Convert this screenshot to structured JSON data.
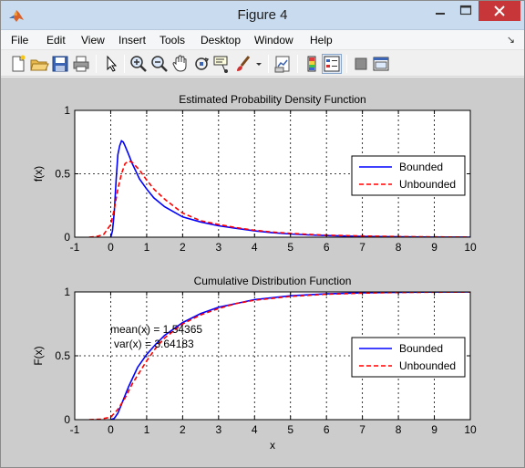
{
  "window": {
    "title": "Figure 4"
  },
  "menu": [
    "File",
    "Edit",
    "View",
    "Insert",
    "Tools",
    "Desktop",
    "Window",
    "Help"
  ],
  "menu_overflow_icon": "dock-arrow-icon",
  "toolbar": {
    "buttons": [
      {
        "name": "new-figure-button",
        "icon": "new-file-icon"
      },
      {
        "name": "open-file-button",
        "icon": "folder-icon"
      },
      {
        "name": "save-figure-button",
        "icon": "save-icon"
      },
      {
        "name": "print-figure-button",
        "icon": "printer-icon"
      },
      {
        "name": "edit-plot-button",
        "icon": "pointer-arrow-icon"
      },
      {
        "name": "zoom-in-button",
        "icon": "zoom-in-icon"
      },
      {
        "name": "zoom-out-button",
        "icon": "zoom-out-icon"
      },
      {
        "name": "pan-button",
        "icon": "hand-icon"
      },
      {
        "name": "rotate-3d-button",
        "icon": "rotate-icon"
      },
      {
        "name": "data-cursor-button",
        "icon": "data-cursor-icon"
      },
      {
        "name": "brush-button",
        "icon": "brush-icon"
      },
      {
        "name": "link-plot-button",
        "icon": "link-icon"
      },
      {
        "name": "insert-colorbar-button",
        "icon": "colorbar-icon"
      },
      {
        "name": "insert-legend-button",
        "icon": "legend-icon",
        "active": true
      },
      {
        "name": "hide-plot-tools-button",
        "icon": "gray-square-icon"
      },
      {
        "name": "show-plot-tools-button",
        "icon": "window-icon"
      }
    ]
  },
  "colors": {
    "bounded": "#0000ff",
    "unbounded": "#ff0000",
    "figure_bg": "#cccccc"
  },
  "chart_data": [
    {
      "type": "line",
      "title": "Estimated Probability Density Function",
      "xlabel": "",
      "ylabel": "f(x)",
      "xlim": [
        -1,
        10
      ],
      "ylim": [
        0,
        1
      ],
      "xticks": [
        -1,
        0,
        1,
        2,
        3,
        4,
        5,
        6,
        7,
        8,
        9,
        10
      ],
      "yticks": [
        0,
        0.5,
        1
      ],
      "ytick_labels": [
        "0",
        "0.5",
        "1"
      ],
      "grid": true,
      "legend": "right",
      "series": [
        {
          "name": "Bounded",
          "style": "solid",
          "x": [
            0,
            0.05,
            0.1,
            0.15,
            0.2,
            0.25,
            0.3,
            0.35,
            0.4,
            0.5,
            0.6,
            0.7,
            0.8,
            1.0,
            1.2,
            1.5,
            2.0,
            2.5,
            3.0,
            3.5,
            4.0,
            4.5,
            5.0,
            5.5,
            6.0,
            7.0,
            8.0,
            9.0,
            10.0
          ],
          "y": [
            0,
            0.05,
            0.2,
            0.45,
            0.65,
            0.72,
            0.76,
            0.75,
            0.72,
            0.65,
            0.58,
            0.52,
            0.46,
            0.38,
            0.31,
            0.24,
            0.16,
            0.12,
            0.09,
            0.07,
            0.05,
            0.035,
            0.025,
            0.018,
            0.013,
            0.006,
            0.003,
            0.001,
            0.0
          ]
        },
        {
          "name": "Unbounded",
          "style": "dashed",
          "x": [
            -0.6,
            -0.4,
            -0.2,
            0,
            0.1,
            0.2,
            0.3,
            0.4,
            0.5,
            0.6,
            0.8,
            1.0,
            1.2,
            1.5,
            2.0,
            2.5,
            3.0,
            3.5,
            4.0,
            4.5,
            5.0,
            5.5,
            6.0,
            7.0,
            8.0,
            9.0,
            10.0
          ],
          "y": [
            0,
            0.005,
            0.02,
            0.1,
            0.22,
            0.38,
            0.5,
            0.58,
            0.6,
            0.59,
            0.53,
            0.45,
            0.38,
            0.3,
            0.19,
            0.13,
            0.1,
            0.075,
            0.055,
            0.04,
            0.03,
            0.022,
            0.016,
            0.009,
            0.005,
            0.002,
            0.001
          ]
        }
      ]
    },
    {
      "type": "line",
      "title": "Cumulative Distribution Function",
      "xlabel": "x",
      "ylabel": "F(x)",
      "xlim": [
        -1,
        10
      ],
      "ylim": [
        0,
        1
      ],
      "xticks": [
        -1,
        0,
        1,
        2,
        3,
        4,
        5,
        6,
        7,
        8,
        9,
        10
      ],
      "yticks": [
        0,
        0.5,
        1
      ],
      "ytick_labels": [
        "0",
        "0.5",
        "1"
      ],
      "grid": true,
      "legend": "right",
      "annotations": [
        "mean(x) = 1.54365",
        "var(x) = 3.64183"
      ],
      "series": [
        {
          "name": "Bounded",
          "style": "solid",
          "x": [
            0,
            0.1,
            0.2,
            0.3,
            0.4,
            0.5,
            0.75,
            1.0,
            1.25,
            1.5,
            2.0,
            2.5,
            3.0,
            3.5,
            4.0,
            5.0,
            6.0,
            7.0,
            8.0,
            9.0,
            10.0
          ],
          "y": [
            0,
            0.01,
            0.05,
            0.12,
            0.19,
            0.26,
            0.41,
            0.51,
            0.59,
            0.66,
            0.76,
            0.83,
            0.88,
            0.91,
            0.94,
            0.97,
            0.985,
            0.993,
            0.997,
            0.999,
            1.0
          ]
        },
        {
          "name": "Unbounded",
          "style": "dashed",
          "x": [
            -0.6,
            -0.3,
            0,
            0.2,
            0.4,
            0.6,
            0.8,
            1.0,
            1.25,
            1.5,
            2.0,
            2.5,
            3.0,
            3.5,
            4.0,
            5.0,
            6.0,
            7.0,
            8.0,
            9.0,
            10.0
          ],
          "y": [
            0,
            0.003,
            0.02,
            0.08,
            0.17,
            0.28,
            0.37,
            0.46,
            0.56,
            0.64,
            0.75,
            0.82,
            0.87,
            0.91,
            0.935,
            0.965,
            0.982,
            0.991,
            0.996,
            0.998,
            0.999
          ]
        }
      ]
    }
  ]
}
